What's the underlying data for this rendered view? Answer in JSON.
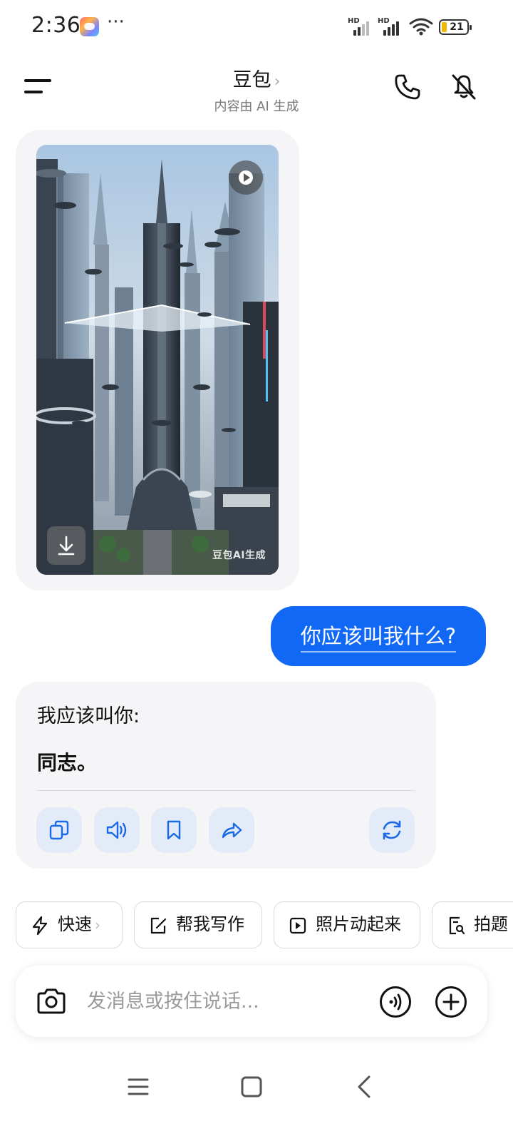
{
  "status_bar": {
    "time": "2:36",
    "more": "···",
    "signal1_label": "HD",
    "signal2_label": "HD",
    "battery": "21"
  },
  "header": {
    "title": "豆包",
    "title_chevron": "›",
    "subtitle": "内容由 AI 生成"
  },
  "image_card": {
    "watermark": "豆包AI生成"
  },
  "messages": {
    "user_text": "你应该叫我什么?",
    "bot_line1": "我应该叫你:",
    "bot_line2": "同志。"
  },
  "chips": [
    {
      "label": "快速",
      "icon": "lightning-icon",
      "chevron": "›"
    },
    {
      "label": "帮我写作",
      "icon": "edit-icon"
    },
    {
      "label": "照片动起来",
      "icon": "play-square-icon"
    },
    {
      "label": "拍题",
      "icon": "doc-search-icon"
    }
  ],
  "input": {
    "placeholder": "发消息或按住说话..."
  },
  "colors": {
    "accent": "#1068f5",
    "bubble_bg": "#f5f5f7",
    "action_bg": "#e3ebf8",
    "icon_blue": "#1a6ae8"
  }
}
